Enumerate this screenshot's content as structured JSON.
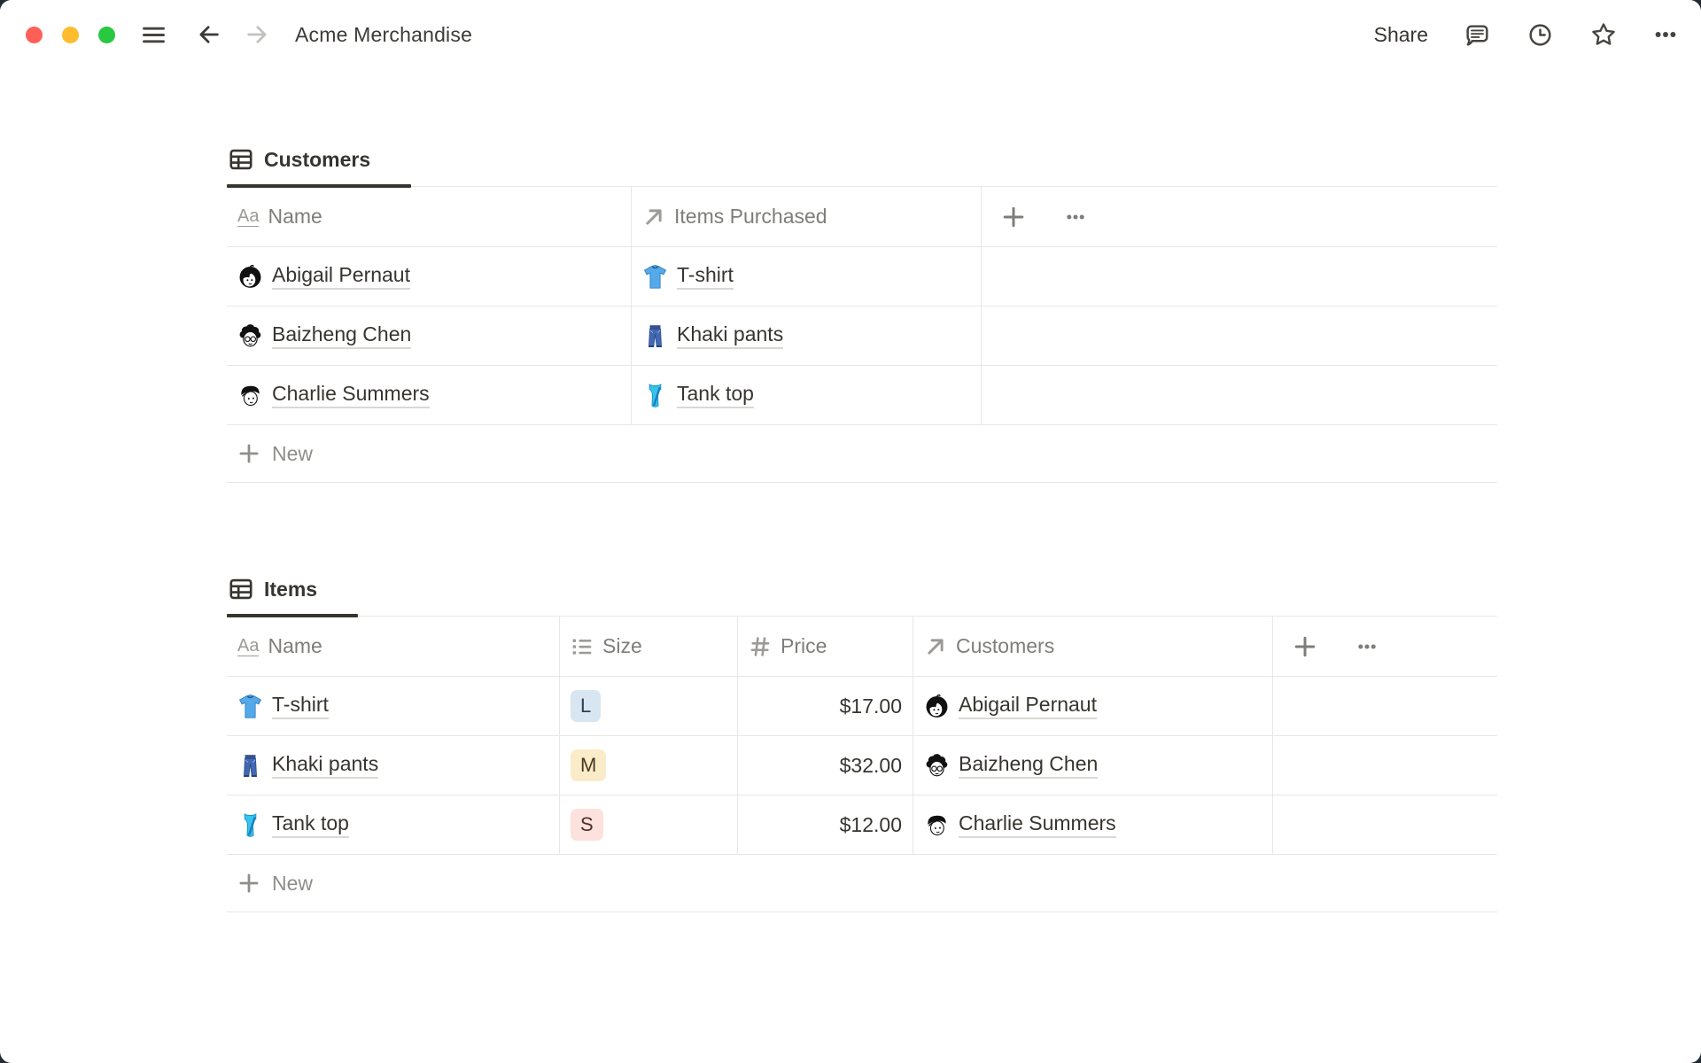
{
  "titlebar": {
    "title": "Acme Merchandise",
    "share_label": "Share",
    "icons": [
      "hamburger-icon",
      "back-icon",
      "forward-icon",
      "comments-icon",
      "updates-clock-icon",
      "favorite-star-icon",
      "more-icon"
    ]
  },
  "customers": {
    "tab_label": "Customers",
    "columns": [
      {
        "icon": "title-type-icon",
        "label": "Name"
      },
      {
        "icon": "relation-type-icon",
        "label": "Items Purchased"
      }
    ],
    "rows": [
      {
        "name": "Abigail Pernaut",
        "avatar": "avatar-abigail-icon",
        "item": "T-shirt",
        "item_icon": "tshirt-icon"
      },
      {
        "name": "Baizheng Chen",
        "avatar": "avatar-baizheng-icon",
        "item": "Khaki pants",
        "item_icon": "jeans-icon"
      },
      {
        "name": "Charlie Summers",
        "avatar": "avatar-charlie-icon",
        "item": "Tank top",
        "item_icon": "tanktop-icon"
      }
    ],
    "new_label": "New"
  },
  "items": {
    "tab_label": "Items",
    "columns": [
      {
        "icon": "title-type-icon",
        "label": "Name"
      },
      {
        "icon": "select-type-icon",
        "label": "Size"
      },
      {
        "icon": "number-type-icon",
        "label": "Price"
      },
      {
        "icon": "relation-type-icon",
        "label": "Customers"
      }
    ],
    "rows": [
      {
        "name": "T-shirt",
        "item_icon": "tshirt-icon",
        "size": "L",
        "size_bg": "#d7e6f1",
        "size_fg": "#2e3f53",
        "price": "$17.00",
        "customer": "Abigail Pernaut",
        "avatar": "avatar-abigail-icon"
      },
      {
        "name": "Khaki pants",
        "item_icon": "jeans-icon",
        "size": "M",
        "size_bg": "#fbecc9",
        "size_fg": "#473a21",
        "price": "$32.00",
        "customer": "Baizheng Chen",
        "avatar": "avatar-baizheng-icon"
      },
      {
        "name": "Tank top",
        "item_icon": "tanktop-icon",
        "size": "S",
        "size_bg": "#fce1dc",
        "size_fg": "#522e29",
        "price": "$12.00",
        "customer": "Charlie Summers",
        "avatar": "avatar-charlie-icon"
      }
    ],
    "new_label": "New"
  },
  "colors": {
    "text": "#37352f",
    "secondary": "#7e7d79",
    "border": "#e8e7e4",
    "active_tab_underline": "#37352f",
    "traffic_red": "#ff5f57",
    "traffic_yellow": "#febc2e",
    "traffic_green": "#28c840"
  }
}
